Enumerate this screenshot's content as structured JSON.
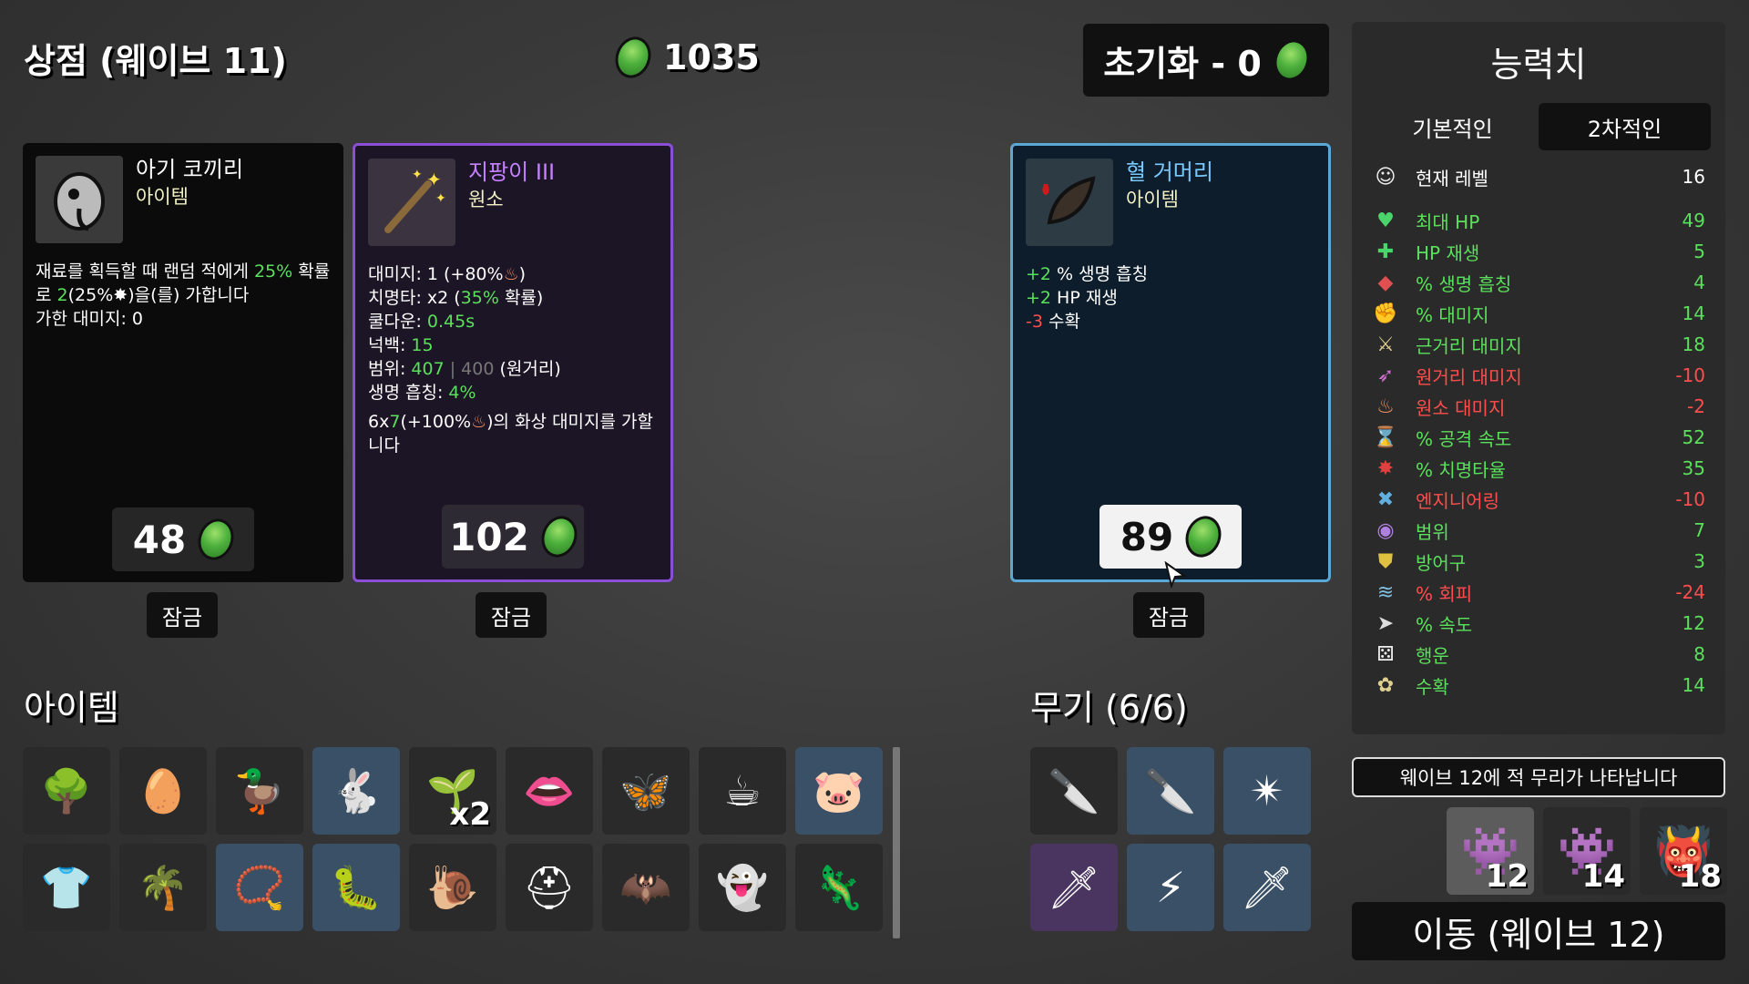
{
  "header": {
    "shop_title": "상점 (웨이브 11)",
    "materials": "1035",
    "reroll_label": "초기화 - 0"
  },
  "shop": {
    "cards": [
      {
        "name": "아기 코끼리",
        "type": "아이템",
        "icon": "baby-elephant-icon",
        "desc_a": "재료를 획득할 때 랜덤 적에게 ",
        "desc_b": "25%",
        "desc_c": " 확률로 ",
        "desc_d": "2",
        "desc_e": "(25%",
        "desc_f": ")을(를) 가합니다",
        "dealt": "가한 대미지: 0",
        "price": "48",
        "lock": "잠금"
      },
      {
        "name": "지팡이 III",
        "type": "원소",
        "icon": "wand-icon",
        "damage_a": "대미지: 1 (+80%",
        "damage_b": ")",
        "crit_a": "치명타: x2 (",
        "crit_b": "35%",
        "crit_c": " 확률)",
        "cooldown_a": "쿨다운: ",
        "cooldown_b": "0.45s",
        "knockback_a": "넉백: ",
        "knockback_b": "15",
        "range_a": "범위: ",
        "range_b": "407",
        "range_c": " | 400",
        "range_d": " (원거리)",
        "lifesteal_a": "생명 흡칭: ",
        "lifesteal_b": "4%",
        "burn_a": "6x",
        "burn_b": "7",
        "burn_c": "(+100%",
        "burn_d": ")의 화상 대미지를 가할 니다",
        "price": "102",
        "lock": "잠금"
      },
      {
        "name": "혈 거머리",
        "type": "아이템",
        "icon": "blood-leech-icon",
        "line1_a": "+2",
        "line1_b": " % 생명 흡칭",
        "line2_a": "+2",
        "line2_b": " HP 재생",
        "line3_a": "-3",
        "line3_b": " 수확",
        "price": "89",
        "lock": "잠금"
      }
    ]
  },
  "items_section": {
    "title": "아이템",
    "items": [
      {
        "icon": "tree-icon",
        "glyph": "🌳",
        "tier": "normal"
      },
      {
        "icon": "egg-face-icon",
        "glyph": "🥚",
        "tier": "normal"
      },
      {
        "icon": "rubber-duck-icon",
        "glyph": "🦆",
        "tier": "normal"
      },
      {
        "icon": "rabbit-icon",
        "glyph": "🐇",
        "tier": "blue"
      },
      {
        "icon": "sprout-icon",
        "glyph": "🌱",
        "tier": "normal",
        "badge": "x2"
      },
      {
        "icon": "scream-mask-icon",
        "glyph": "👄",
        "tier": "normal"
      },
      {
        "icon": "butterfly-icon",
        "glyph": "🦋",
        "tier": "normal"
      },
      {
        "icon": "coffee-cup-icon",
        "glyph": "☕",
        "tier": "normal"
      },
      {
        "icon": "piggy-bank-icon",
        "glyph": "🐷",
        "tier": "blue"
      },
      {
        "icon": "lumberjack-shirt-icon",
        "glyph": "👕",
        "tier": "normal"
      },
      {
        "icon": "palm-tree-icon",
        "glyph": "🌴",
        "tier": "normal"
      },
      {
        "icon": "pendant-icon",
        "glyph": "📿",
        "tier": "blue"
      },
      {
        "icon": "worm-icon",
        "glyph": "🐛",
        "tier": "blue"
      },
      {
        "icon": "snail-icon",
        "glyph": "🐌",
        "tier": "normal"
      },
      {
        "icon": "helmet-icon",
        "glyph": "⛑",
        "tier": "normal"
      },
      {
        "icon": "bat-icon",
        "glyph": "🦇",
        "tier": "normal"
      },
      {
        "icon": "ghost-icon",
        "glyph": "👻",
        "tier": "normal"
      },
      {
        "icon": "lizard-icon",
        "glyph": "🦎",
        "tier": "normal"
      }
    ]
  },
  "weapons_section": {
    "title": "무기 (6/6)",
    "weapons": [
      {
        "icon": "knife-icon",
        "glyph": "🔪",
        "tier": "normal"
      },
      {
        "icon": "knife-icon",
        "glyph": "🔪",
        "tier": "blue"
      },
      {
        "icon": "shuriken-icon",
        "glyph": "✴",
        "tier": "blue"
      },
      {
        "icon": "knife-icon",
        "glyph": "🗡",
        "tier": "purple"
      },
      {
        "icon": "lightning-sword-icon",
        "glyph": "⚡",
        "tier": "blue"
      },
      {
        "icon": "knife-icon",
        "glyph": "🗡",
        "tier": "blue"
      }
    ]
  },
  "stats_panel": {
    "title": "능력치",
    "tab_primary": "기본적인",
    "tab_secondary": "2차적인",
    "level_label": "현재 레벨",
    "level_value": "16",
    "rows": [
      {
        "icon": "heart-icon",
        "glyph": "♥",
        "icon_color": "#4bd46a",
        "name": "최대 HP",
        "value": "49",
        "color": "#5be05b"
      },
      {
        "icon": "hp-regen-icon",
        "glyph": "✚",
        "icon_color": "#4bd46a",
        "name": "HP 재생",
        "value": "5",
        "color": "#5be05b"
      },
      {
        "icon": "lifesteal-icon",
        "glyph": "◆",
        "icon_color": "#e05050",
        "name": "% 생명 흡칭",
        "value": "4",
        "color": "#5be05b"
      },
      {
        "icon": "damage-icon",
        "glyph": "✊",
        "icon_color": "#e08080",
        "name": "% 대미지",
        "value": "14",
        "color": "#5be05b"
      },
      {
        "icon": "melee-damage-icon",
        "glyph": "⚔",
        "icon_color": "#e0d090",
        "name": "근거리 대미지",
        "value": "18",
        "color": "#5be05b"
      },
      {
        "icon": "ranged-damage-icon",
        "glyph": "➶",
        "icon_color": "#d070d0",
        "name": "원거리 대미지",
        "value": "-10",
        "color": "#ff4d4d"
      },
      {
        "icon": "elemental-damage-icon",
        "glyph": "♨",
        "icon_color": "#f09060",
        "name": "원소 대미지",
        "value": "-2",
        "color": "#ff4d4d"
      },
      {
        "icon": "attack-speed-icon",
        "glyph": "⌛",
        "icon_color": "#dddddd",
        "name": "% 공격 속도",
        "value": "52",
        "color": "#5be05b"
      },
      {
        "icon": "crit-chance-icon",
        "glyph": "✸",
        "icon_color": "#e04040",
        "name": "% 치명타율",
        "value": "35",
        "color": "#5be05b"
      },
      {
        "icon": "engineering-icon",
        "glyph": "✖",
        "icon_color": "#60b0e0",
        "name": "엔지니어링",
        "value": "-10",
        "color": "#ff4d4d"
      },
      {
        "icon": "range-icon",
        "glyph": "◉",
        "icon_color": "#b080e0",
        "name": "범위",
        "value": "7",
        "color": "#5be05b"
      },
      {
        "icon": "armor-icon",
        "glyph": "⛊",
        "icon_color": "#e0c040",
        "name": "방어구",
        "value": "3",
        "color": "#5be05b"
      },
      {
        "icon": "dodge-icon",
        "glyph": "≋",
        "icon_color": "#80c0e0",
        "name": "% 회피",
        "value": "-24",
        "color": "#ff4d4d"
      },
      {
        "icon": "speed-icon",
        "glyph": "➤",
        "icon_color": "#dddddd",
        "name": "% 속도",
        "value": "12",
        "color": "#5be05b"
      },
      {
        "icon": "luck-icon",
        "glyph": "⚄",
        "icon_color": "#eeeeee",
        "name": "행운",
        "value": "8",
        "color": "#5be05b"
      },
      {
        "icon": "harvesting-icon",
        "glyph": "✿",
        "icon_color": "#e0d090",
        "name": "수확",
        "value": "14",
        "color": "#5be05b"
      }
    ]
  },
  "wave": {
    "horde_warning": "웨이브 12에 적 무리가 나타납니다",
    "enemies": [
      {
        "icon": "enemy-group-icon",
        "glyph": "👾",
        "count": "12"
      },
      {
        "icon": "enemy-group-icon",
        "glyph": "👾",
        "count": "14"
      },
      {
        "icon": "horned-enemy-icon",
        "glyph": "👹",
        "count": "18"
      }
    ],
    "go_label": "이동 (웨이브 12)"
  },
  "colors": {
    "legendary_border": "#8a4fd6",
    "rare_border": "#5aa8d6",
    "positive": "#5be05b",
    "negative": "#ff4d4d"
  }
}
